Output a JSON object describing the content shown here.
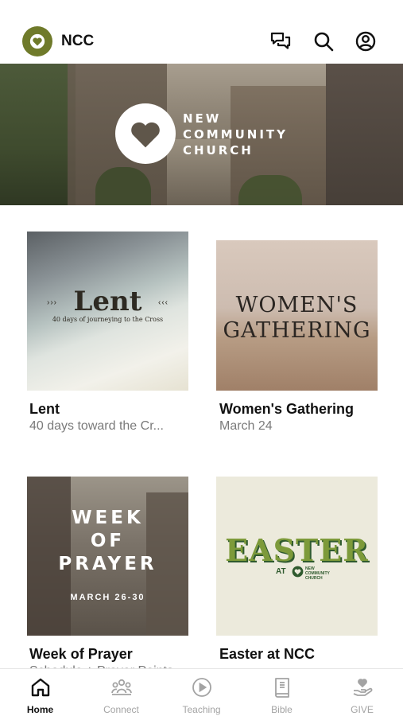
{
  "status_bar": {
    "time": ""
  },
  "header": {
    "brand_name": "NCC",
    "icons": {
      "avatar": "heart-logo-icon",
      "chat": "chat-icon",
      "search": "search-icon",
      "profile": "profile-icon"
    }
  },
  "hero": {
    "logo_lines": [
      "NEW",
      "COMMUNITY",
      "CHURCH"
    ]
  },
  "cards": [
    {
      "title": "Lent",
      "subtitle": "40 days toward the Cr...",
      "art": {
        "heading": "Lent",
        "tagline": "40 days of journeying to the Cross",
        "arrows_left": "›››",
        "arrows_right": "‹‹‹"
      }
    },
    {
      "title": "Women's Gathering",
      "subtitle": "March 24",
      "art": {
        "line1": "WOMEN'S",
        "line2": "GATHERING"
      }
    },
    {
      "title": "Week of Prayer",
      "subtitle": "Schedule + Prayer Points",
      "art": {
        "line1": "WEEK",
        "line2": "OF",
        "line3": "PRAYER",
        "dates": "MARCH 26-30"
      }
    },
    {
      "title": "Easter at NCC",
      "subtitle": "",
      "art": {
        "heading": "EASTER",
        "at": "AT",
        "org": [
          "NEW",
          "COMMUNITY",
          "CHURCH"
        ]
      }
    }
  ],
  "tab_bar": {
    "tabs": [
      {
        "label": "Home",
        "icon": "home-icon",
        "active": true
      },
      {
        "label": "Connect",
        "icon": "people-icon",
        "active": false
      },
      {
        "label": "Teaching",
        "icon": "play-circle-icon",
        "active": false
      },
      {
        "label": "Bible",
        "icon": "book-icon",
        "active": false
      },
      {
        "label": "GIVE",
        "icon": "heart-hand-icon",
        "active": false
      }
    ]
  },
  "colors": {
    "brand": "#6f7a2a",
    "easter_green": "#7d9a3a",
    "tab_inactive": "#a3a3a3"
  }
}
